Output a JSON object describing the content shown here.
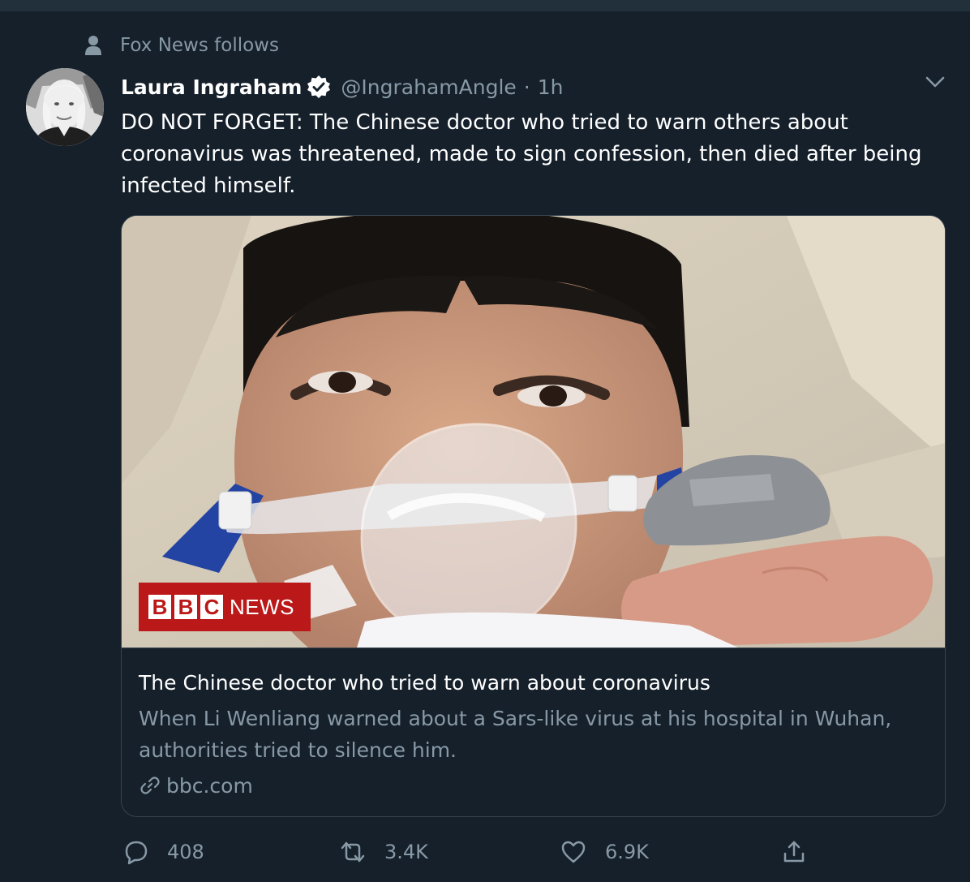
{
  "social_context": {
    "text": "Fox News follows"
  },
  "tweet": {
    "author_name": "Laura Ingraham",
    "handle": "@IngrahamAngle",
    "separator": "·",
    "time": "1h",
    "text": "DO NOT FORGET: The Chinese doctor who tried to warn others about coronavirus was threatened, made to sign confession, then died after being infected himself."
  },
  "card": {
    "badge": {
      "letters": [
        "B",
        "B",
        "C"
      ],
      "word": "NEWS"
    },
    "title": "The Chinese doctor who tried to warn about coronavirus",
    "description": "When Li Wenliang warned about a Sars-like virus at his hospital in Wuhan, authorities tried to silence him.",
    "domain": "bbc.com"
  },
  "actions": {
    "reply_count": "408",
    "retweet_count": "3.4K",
    "like_count": "6.9K"
  },
  "colors": {
    "background": "#15202b",
    "secondary_text": "#8899a6",
    "border": "#38444d",
    "bbc_red": "#bb1919"
  },
  "icons": [
    "person-icon",
    "verified-icon",
    "chevron-down-icon",
    "link-icon",
    "reply-icon",
    "retweet-icon",
    "like-icon",
    "share-icon"
  ]
}
